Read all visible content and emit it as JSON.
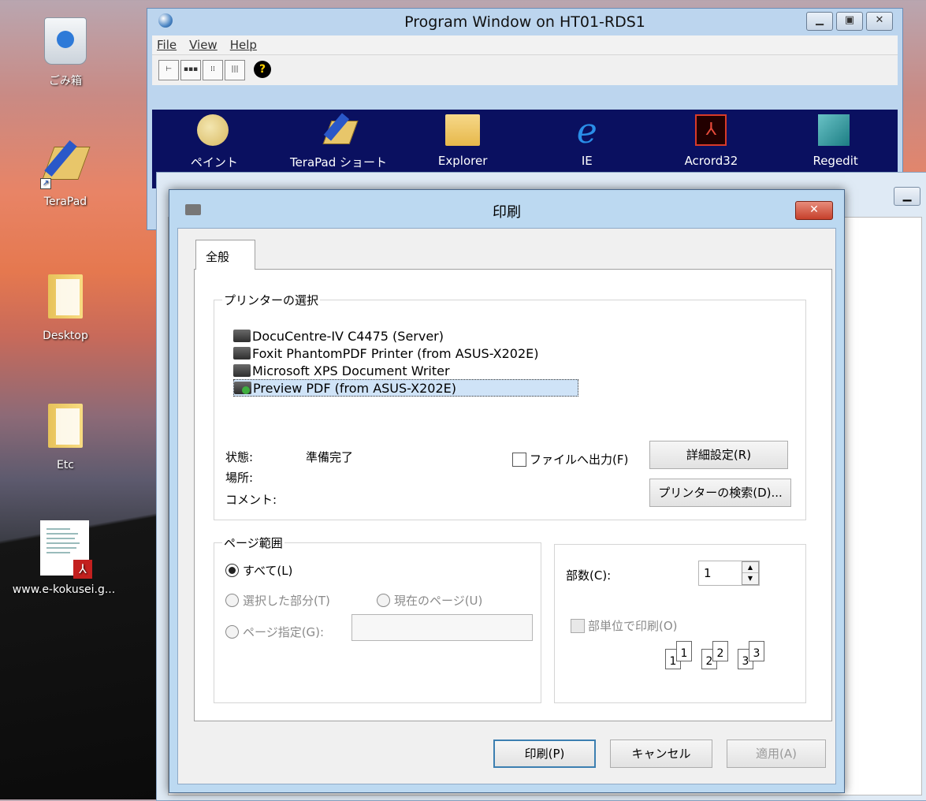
{
  "desktop": {
    "icons": [
      {
        "label": "ごみ箱"
      },
      {
        "label": "TeraPad"
      },
      {
        "label": "Desktop"
      },
      {
        "label": "Etc"
      },
      {
        "label": "www.e-kokusei.g..."
      }
    ]
  },
  "program_window": {
    "title": "Program Window on HT01-RDS1",
    "menu": [
      "File",
      "View",
      "Help"
    ],
    "launchers": [
      "ペイント",
      "TeraPad ショートカ",
      "Explorer",
      "IE",
      "Acrord32",
      "Regedit"
    ]
  },
  "print_dialog": {
    "title": "印刷",
    "tab": "全般",
    "printer_group": "プリンターの選択",
    "printers": [
      "DocuCentre-IV C4475 (Server)",
      "Foxit PhantomPDF Printer (from ASUS-X202E)",
      "Microsoft XPS Document Writer",
      "Preview PDF (from ASUS-X202E)"
    ],
    "selected_printer": "Preview PDF (from ASUS-X202E)",
    "status_label": "状態:",
    "status_value": "準備完了",
    "location_label": "場所:",
    "comment_label": "コメント:",
    "print_to_file": "ファイルへ出力(F)",
    "print_to_file_checked": false,
    "preferences_button": "詳細設定(R)",
    "find_printer_button": "プリンターの検索(D)...",
    "page_range": {
      "group": "ページ範囲",
      "all": "すべて(L)",
      "selection": "選択した部分(T)",
      "current_page": "現在のページ(U)",
      "pages": "ページ指定(G):",
      "pages_value": ""
    },
    "copies": {
      "label": "部数(C):",
      "value": "1",
      "collate": "部単位で印刷(O)",
      "collate_checked": false
    },
    "buttons": {
      "print": "印刷(P)",
      "cancel": "キャンセル",
      "apply": "適用(A)"
    }
  }
}
